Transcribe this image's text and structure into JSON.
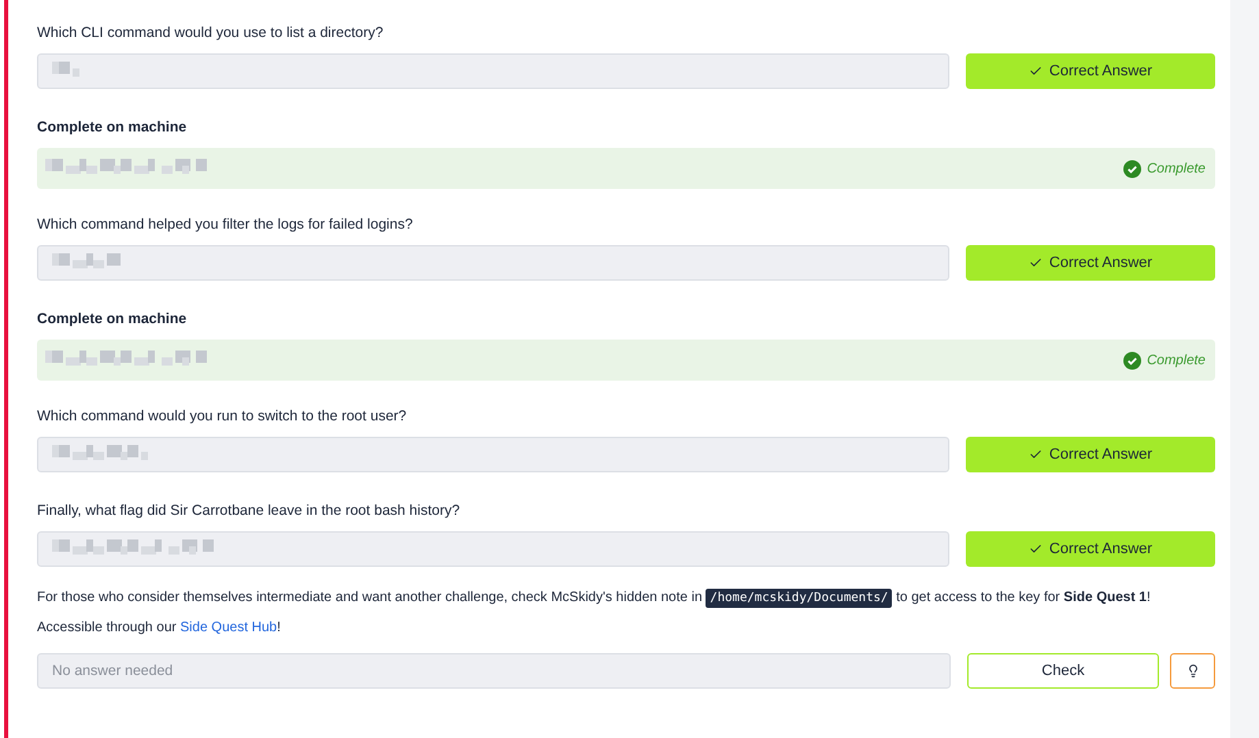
{
  "items": [
    {
      "kind": "question",
      "label": "Which CLI command would you use to list a directory?",
      "redacted": true,
      "button": "Correct Answer"
    },
    {
      "kind": "machine",
      "label": "Complete on machine",
      "redacted": true,
      "status": "Complete"
    },
    {
      "kind": "question",
      "label": "Which command helped you filter the logs for failed logins?",
      "redacted": true,
      "button": "Correct Answer"
    },
    {
      "kind": "machine",
      "label": "Complete on machine",
      "redacted": true,
      "status": "Complete"
    },
    {
      "kind": "question",
      "label": "Which command would you run to switch to the root user?",
      "redacted": true,
      "button": "Correct Answer"
    },
    {
      "kind": "question",
      "label": "Finally, what flag did Sir Carrotbane leave in the root bash history?",
      "redacted": true,
      "button": "Correct Answer"
    }
  ],
  "note": {
    "before": "For those who consider themselves intermediate and want another challenge, check McSkidy's hidden note in",
    "path": "/home/mcskidy/Documents/",
    "after": "to get access to the key for **Side Quest 1**!",
    "line2": "Accessible through our",
    "link": "Side Quest Hub",
    "end": "!"
  },
  "final": {
    "placeholder": "No answer needed",
    "button": "Check"
  }
}
